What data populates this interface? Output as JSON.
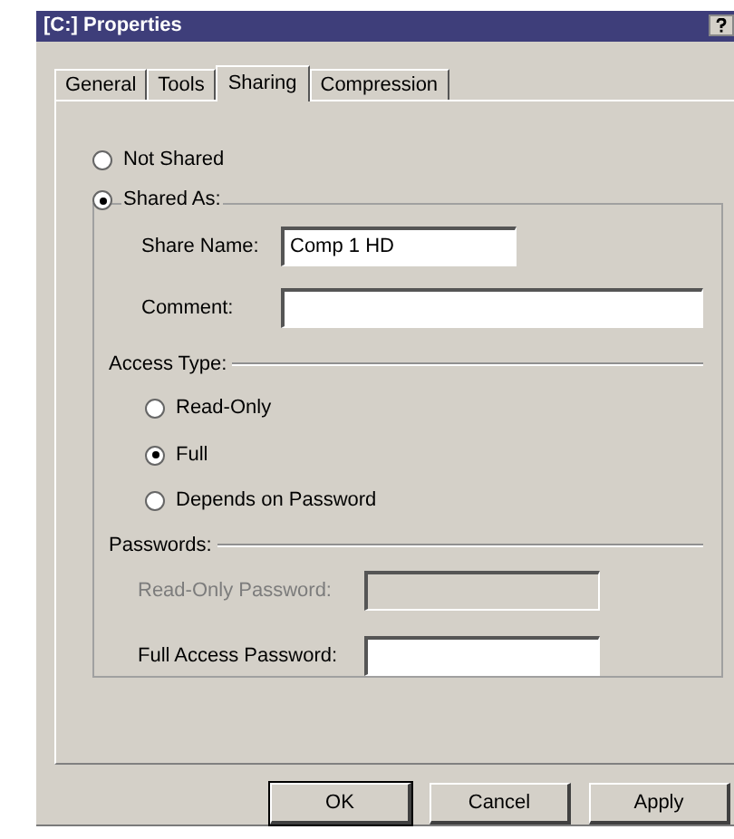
{
  "window": {
    "title": "[C:] Properties"
  },
  "tabs": [
    {
      "label": "General",
      "selected": false
    },
    {
      "label": "Tools",
      "selected": false
    },
    {
      "label": "Sharing",
      "selected": true
    },
    {
      "label": "Compression",
      "selected": false
    }
  ],
  "share_mode": [
    {
      "label": "Not Shared",
      "selected": false
    },
    {
      "label": "Shared As:",
      "selected": true
    }
  ],
  "share_fields": [
    {
      "label": "Share Name:",
      "value": "Comp 1 HD",
      "wide": false
    },
    {
      "label": "Comment:",
      "wide": true
    }
  ],
  "access_type": {
    "title": "Access Type:",
    "options": [
      {
        "label": "Read-Only",
        "selected": false
      },
      {
        "label": "Full",
        "selected": true
      },
      {
        "label": "Depends on Password",
        "selected": false
      }
    ]
  },
  "passwords": {
    "title": "Passwords:",
    "fields": [
      {
        "label": "Read-Only Password:",
        "disabled": true
      },
      {
        "label": "Full Access Password:",
        "disabled": false
      }
    ]
  },
  "buttons": [
    "OK",
    "Cancel",
    "Apply"
  ]
}
